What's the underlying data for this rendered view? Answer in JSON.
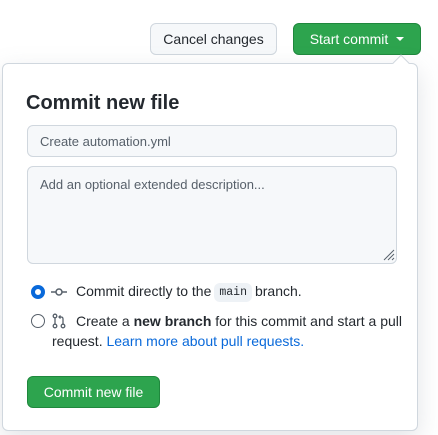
{
  "header": {
    "cancel_label": "Cancel changes",
    "start_commit_label": "Start commit"
  },
  "commit_panel": {
    "title": "Commit new file",
    "summary_placeholder": "Create automation.yml",
    "description_placeholder": "Add an optional extended description...",
    "options": [
      {
        "selected": true,
        "text_before": "Commit directly to the",
        "branch": "main",
        "text_after": "branch."
      },
      {
        "selected": false,
        "text_before": "Create a",
        "bold": "new branch",
        "text_after": "for this commit and start a pull",
        "line2": "request.",
        "link": "Learn more about pull requests."
      }
    ],
    "commit_button_label": "Commit new file"
  },
  "colors": {
    "primary_green": "#2da44e",
    "link_blue": "#0969da",
    "border": "#d0d7de"
  },
  "icons": {
    "option_1": "git-commit-icon",
    "option_2": "git-pull-request-icon",
    "start_commit_caret": "triangle-down-icon"
  }
}
